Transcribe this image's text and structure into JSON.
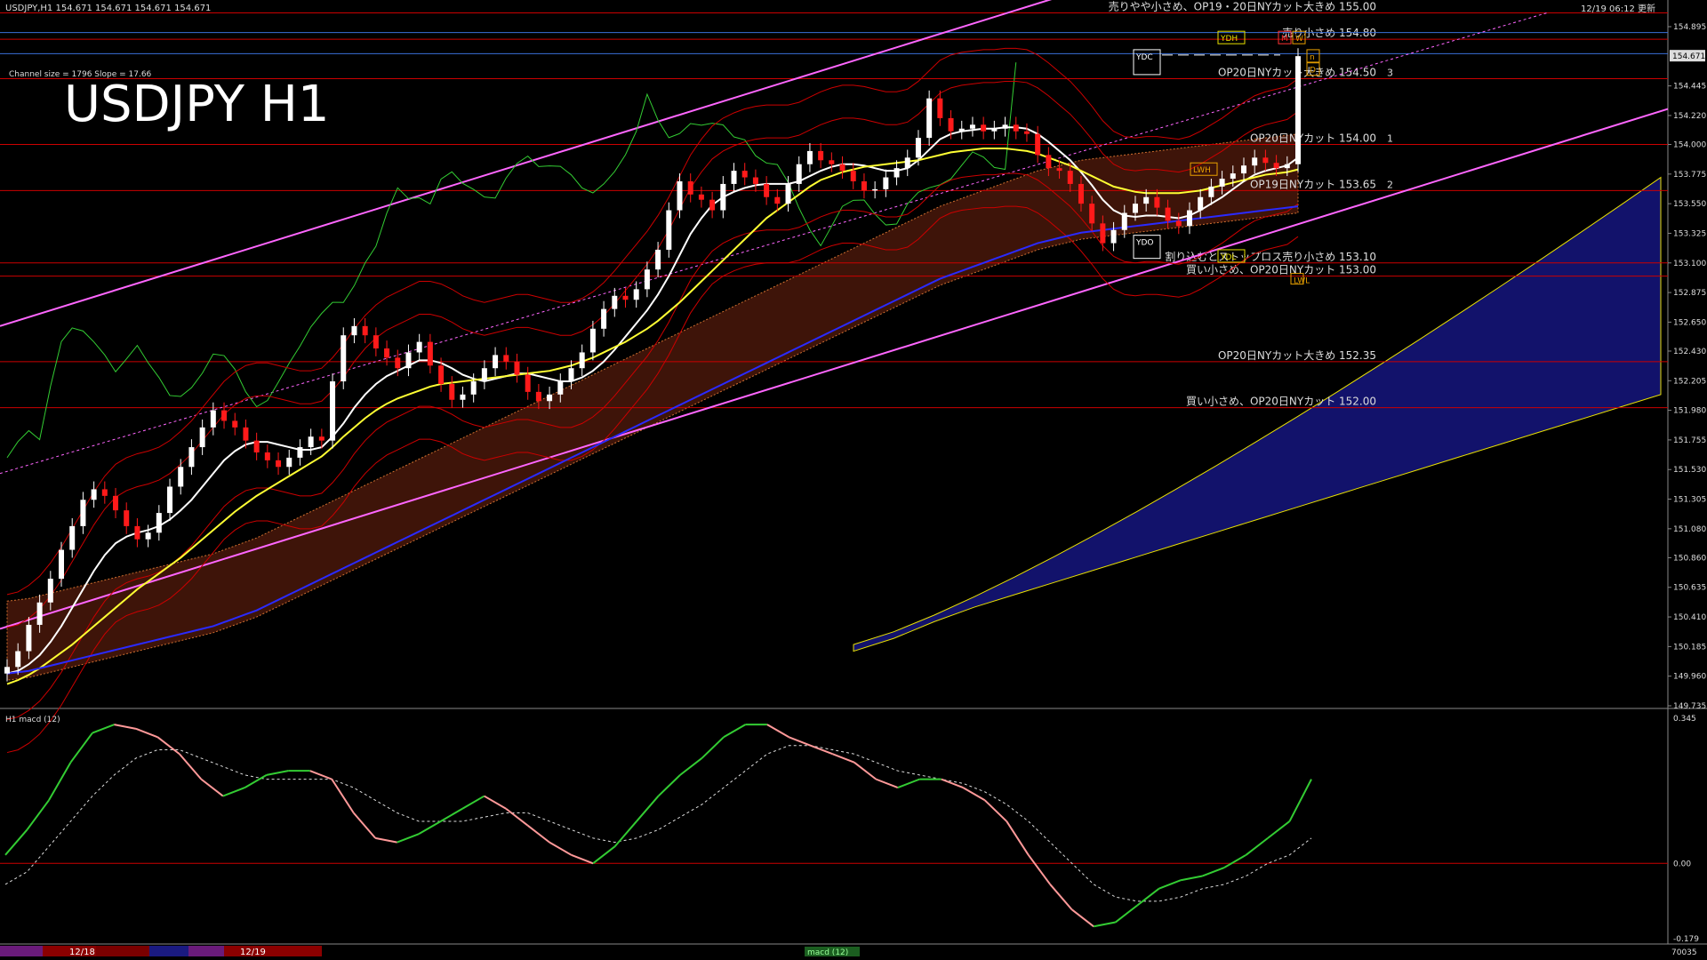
{
  "header": {
    "symbol_info": "USDJPY,H1  154.671 154.671 154.671 154.671",
    "update_time": "12/19 06:12 更新",
    "channel_info": "Channel size = 1796 Slope = 17.66",
    "big_title": "USDJPY H1"
  },
  "colors": {
    "background": "#000000",
    "bull_candle": "#ffffff",
    "bear_candle": "#ff1a1a",
    "channel": "#ff66ff",
    "sma_short": "#ffffff",
    "sma_mid": "#ffff33",
    "sma_long": "#2a2aff",
    "bollinger": "#cc0000",
    "chikou": "#33cc33",
    "kumo_bear": "#b33a1a",
    "kumo_bull": "#1a1a99",
    "level_line": "#cc0000",
    "macd_main_up": "#33cc33",
    "macd_main_down": "#ff9999",
    "macd_signal": "#dddddd"
  },
  "chart_data": [
    {
      "type": "candlestick",
      "title": "USDJPY H1",
      "ylim": [
        149.735,
        154.895
      ],
      "grid": false,
      "price_axis_ticks": [
        "154.895",
        "154.671",
        "154.445",
        "154.220",
        "154.000",
        "153.775",
        "153.550",
        "153.325",
        "153.100",
        "152.875",
        "152.650",
        "152.430",
        "152.205",
        "151.980",
        "151.755",
        "151.530",
        "151.305",
        "151.080",
        "150.860",
        "150.635",
        "150.410",
        "150.185",
        "149.960",
        "149.735"
      ],
      "current_price": "154.671",
      "close_series": [
        150.03,
        150.15,
        150.35,
        150.52,
        150.7,
        150.92,
        151.1,
        151.3,
        151.38,
        151.33,
        151.22,
        151.1,
        151.0,
        151.05,
        151.2,
        151.4,
        151.55,
        151.7,
        151.85,
        151.98,
        151.9,
        151.85,
        151.75,
        151.66,
        151.6,
        151.55,
        151.62,
        151.7,
        151.78,
        151.75,
        152.2,
        152.55,
        152.62,
        152.55,
        152.45,
        152.38,
        152.3,
        152.42,
        152.5,
        152.32,
        152.18,
        152.06,
        152.1,
        152.2,
        152.3,
        152.4,
        152.35,
        152.25,
        152.12,
        152.05,
        152.1,
        152.2,
        152.3,
        152.42,
        152.6,
        152.75,
        152.85,
        152.82,
        152.9,
        153.05,
        153.2,
        153.5,
        153.72,
        153.62,
        153.58,
        153.5,
        153.7,
        153.8,
        153.75,
        153.7,
        153.6,
        153.55,
        153.7,
        153.85,
        153.95,
        153.88,
        153.85,
        153.8,
        153.72,
        153.65,
        153.66,
        153.75,
        153.82,
        153.9,
        154.05,
        154.35,
        154.2,
        154.1,
        154.12,
        154.15,
        154.1,
        154.12,
        154.15,
        154.1,
        154.08,
        153.92,
        153.82,
        153.8,
        153.7,
        153.55,
        153.4,
        153.25,
        153.35,
        153.48,
        153.55,
        153.6,
        153.52,
        153.42,
        153.38,
        153.5,
        153.6,
        153.68,
        153.74,
        153.78,
        153.84,
        153.9,
        153.86,
        153.82,
        153.85,
        154.671
      ],
      "series": [
        {
          "name": "SMA short",
          "values": [
            149.98,
            150.0,
            150.05,
            150.12,
            150.22,
            150.34,
            150.48,
            150.62,
            150.76,
            150.88,
            150.97,
            151.02,
            151.05,
            151.07,
            151.1,
            151.15,
            151.22,
            151.3,
            151.4,
            151.5,
            151.6,
            151.67,
            151.72,
            151.74,
            151.74,
            151.72,
            151.7,
            151.68,
            151.68,
            151.7,
            151.78,
            151.88,
            152.0,
            152.1,
            152.18,
            152.24,
            152.28,
            152.32,
            152.36,
            152.36,
            152.34,
            152.3,
            152.25,
            152.22,
            152.2,
            152.22,
            152.24,
            152.26,
            152.26,
            152.24,
            152.22,
            152.2,
            152.2,
            152.23,
            152.28,
            152.35,
            152.44,
            152.54,
            152.64,
            152.74,
            152.86,
            153.0,
            153.16,
            153.32,
            153.44,
            153.54,
            153.6,
            153.64,
            153.67,
            153.69,
            153.7,
            153.7,
            153.7,
            153.72,
            153.76,
            153.8,
            153.83,
            153.85,
            153.85,
            153.84,
            153.82,
            153.8,
            153.8,
            153.82,
            153.88,
            153.96,
            154.04,
            154.08,
            154.1,
            154.11,
            154.12,
            154.12,
            154.13,
            154.13,
            154.12,
            154.08,
            154.02,
            153.95,
            153.88,
            153.79,
            153.69,
            153.58,
            153.5,
            153.46,
            153.45,
            153.46,
            153.46,
            153.45,
            153.44,
            153.46,
            153.5,
            153.55,
            153.6,
            153.66,
            153.72,
            153.77,
            153.8,
            153.82,
            153.84,
            153.9
          ]
        },
        {
          "name": "SMA mid",
          "values": [
            149.9,
            149.93,
            149.97,
            150.02,
            150.08,
            150.14,
            150.2,
            150.27,
            150.34,
            150.41,
            150.48,
            150.55,
            150.62,
            150.68,
            150.74,
            150.8,
            150.86,
            150.93,
            151.0,
            151.07,
            151.14,
            151.21,
            151.27,
            151.33,
            151.38,
            151.43,
            151.48,
            151.53,
            151.58,
            151.63,
            151.7,
            151.78,
            151.85,
            151.92,
            151.98,
            152.03,
            152.07,
            152.1,
            152.13,
            152.16,
            152.18,
            152.19,
            152.2,
            152.21,
            152.22,
            152.23,
            152.24,
            152.25,
            152.26,
            152.27,
            152.28,
            152.3,
            152.32,
            152.35,
            152.38,
            152.42,
            152.46,
            152.5,
            152.55,
            152.6,
            152.66,
            152.73,
            152.8,
            152.88,
            152.96,
            153.04,
            153.12,
            153.2,
            153.28,
            153.36,
            153.44,
            153.5,
            153.56,
            153.62,
            153.68,
            153.73,
            153.76,
            153.79,
            153.81,
            153.83,
            153.84,
            153.85,
            153.86,
            153.87,
            153.88,
            153.9,
            153.92,
            153.94,
            153.95,
            153.96,
            153.97,
            153.97,
            153.97,
            153.96,
            153.95,
            153.93,
            153.9,
            153.87,
            153.84,
            153.8,
            153.76,
            153.72,
            153.68,
            153.66,
            153.64,
            153.63,
            153.63,
            153.63,
            153.63,
            153.64,
            153.65,
            153.67,
            153.69,
            153.71,
            153.73,
            153.75,
            153.77,
            153.78,
            153.79,
            153.81
          ]
        },
        {
          "name": "SMA long",
          "values": [
            149.98,
            149.99,
            150.0,
            150.02,
            150.04,
            150.06,
            150.08,
            150.1,
            150.12,
            150.14,
            150.16,
            150.18,
            150.2,
            150.22,
            150.24,
            150.26,
            150.28,
            150.3,
            150.32,
            150.34,
            150.37,
            150.4,
            150.43,
            150.46,
            150.5,
            150.54,
            150.58,
            150.62,
            150.66,
            150.7,
            150.74,
            150.78,
            150.82,
            150.86,
            150.9,
            150.94,
            150.98,
            151.02,
            151.06,
            151.1,
            151.14,
            151.18,
            151.22,
            151.26,
            151.3,
            151.34,
            151.38,
            151.42,
            151.46,
            151.5,
            151.54,
            151.58,
            151.62,
            151.66,
            151.7,
            151.74,
            151.78,
            151.82,
            151.86,
            151.9,
            151.94,
            151.98,
            152.02,
            152.06,
            152.1,
            152.14,
            152.18,
            152.22,
            152.26,
            152.3,
            152.34,
            152.38,
            152.42,
            152.46,
            152.5,
            152.54,
            152.58,
            152.62,
            152.66,
            152.7,
            152.74,
            152.78,
            152.82,
            152.86,
            152.9,
            152.94,
            152.98,
            153.01,
            153.04,
            153.07,
            153.1,
            153.13,
            153.16,
            153.19,
            153.22,
            153.25,
            153.27,
            153.29,
            153.31,
            153.33,
            153.34,
            153.35,
            153.36,
            153.37,
            153.38,
            153.39,
            153.4,
            153.41,
            153.42,
            153.43,
            153.44,
            153.45,
            153.46,
            153.47,
            153.48,
            153.49,
            153.5,
            153.51,
            153.52,
            153.53
          ]
        }
      ],
      "level_lines": [
        {
          "price": 155.0,
          "label": "売りやや小さめ、OP19・20日NYカット大きめ 155.00"
        },
        {
          "price": 154.8,
          "label": "売り小さめ 154.80"
        },
        {
          "price": 154.5,
          "label": "OP20日NYカット大きめ 154.50"
        },
        {
          "price": 154.0,
          "label": "OP20日NYカット 154.00"
        },
        {
          "price": 153.65,
          "label": "OP19日NYカット 153.65"
        },
        {
          "price": 153.1,
          "label": "割り込むとストップロス売り小さめ 153.10"
        },
        {
          "price": 153.0,
          "label": "買い小さめ、OP20日NYカット 153.00"
        },
        {
          "price": 152.35,
          "label": "OP20日NYカット大きめ 152.35"
        },
        {
          "price": 152.0,
          "label": "買い小さめ、OP20日NYカット 152.00"
        }
      ],
      "level_numbers": [
        "3",
        "1",
        "2"
      ],
      "boxes": [
        "YDC",
        "YDO",
        "YDH",
        "YDL",
        "LWH",
        "M",
        "W",
        "D",
        "n",
        "LWL"
      ]
    },
    {
      "type": "line",
      "title": "H1  macd (12)",
      "ylim": [
        -0.179,
        0.345
      ],
      "axis_ticks": [
        "0.345",
        "0.00",
        "-0.179"
      ],
      "zero_label": "0.00",
      "series": [
        {
          "name": "main",
          "values": [
            0.02,
            0.08,
            0.15,
            0.24,
            0.31,
            0.33,
            0.32,
            0.3,
            0.26,
            0.2,
            0.16,
            0.18,
            0.21,
            0.22,
            0.22,
            0.2,
            0.12,
            0.06,
            0.05,
            0.07,
            0.1,
            0.13,
            0.16,
            0.13,
            0.09,
            0.05,
            0.02,
            0.0,
            0.04,
            0.1,
            0.16,
            0.21,
            0.25,
            0.3,
            0.33,
            0.33,
            0.3,
            0.28,
            0.26,
            0.24,
            0.2,
            0.18,
            0.2,
            0.2,
            0.18,
            0.15,
            0.1,
            0.02,
            -0.05,
            -0.11,
            -0.15,
            -0.14,
            -0.1,
            -0.06,
            -0.04,
            -0.03,
            -0.01,
            0.02,
            0.06,
            0.1,
            0.2
          ]
        },
        {
          "name": "signal",
          "values": [
            -0.05,
            -0.02,
            0.04,
            0.1,
            0.16,
            0.21,
            0.25,
            0.27,
            0.27,
            0.25,
            0.23,
            0.21,
            0.2,
            0.2,
            0.2,
            0.2,
            0.18,
            0.15,
            0.12,
            0.1,
            0.1,
            0.1,
            0.11,
            0.12,
            0.12,
            0.1,
            0.08,
            0.06,
            0.05,
            0.06,
            0.08,
            0.11,
            0.14,
            0.18,
            0.22,
            0.26,
            0.28,
            0.28,
            0.27,
            0.26,
            0.24,
            0.22,
            0.21,
            0.2,
            0.19,
            0.17,
            0.14,
            0.1,
            0.05,
            0.0,
            -0.05,
            -0.08,
            -0.09,
            -0.09,
            -0.08,
            -0.06,
            -0.05,
            -0.03,
            0.0,
            0.02,
            0.06
          ]
        }
      ]
    }
  ],
  "footer": {
    "date_label_1": "12/18",
    "date_label_2": "12/19",
    "indicator_tag": "macd (12)",
    "bottom_right": "70035"
  }
}
